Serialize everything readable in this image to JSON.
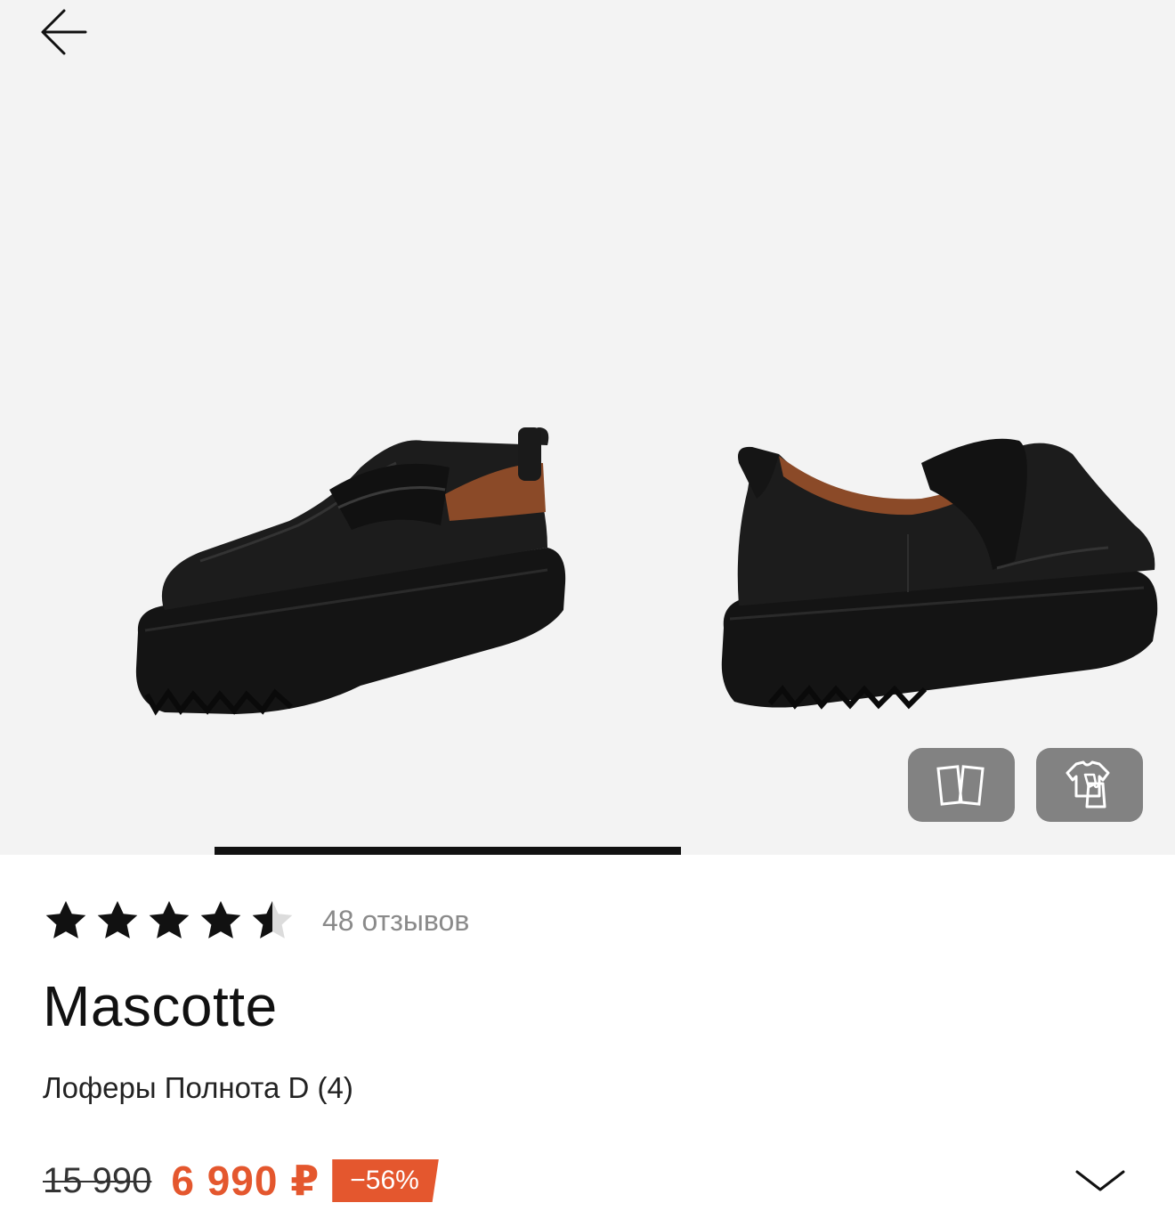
{
  "nav": {
    "back_icon": "arrow-left-icon"
  },
  "gallery": {
    "images": [
      "loafer-front-three-quarter",
      "loafer-rear-three-quarter"
    ],
    "actions": [
      {
        "icon": "compare-icon"
      },
      {
        "icon": "virtual-fitting-icon"
      }
    ],
    "progress": 0.4
  },
  "product": {
    "rating": 4.5,
    "rating_max": 5,
    "reviews_label": "48 отзывов",
    "brand": "Mascotte",
    "name": "Лоферы Полнота D (4)"
  },
  "price": {
    "old": "15 990",
    "current": "6 990 ₽",
    "discount": "−56%"
  },
  "colors": {
    "accent": "#e4572e",
    "star_filled": "#111111",
    "star_empty": "#d9d9d9"
  },
  "expand_icon": "chevron-down-icon"
}
